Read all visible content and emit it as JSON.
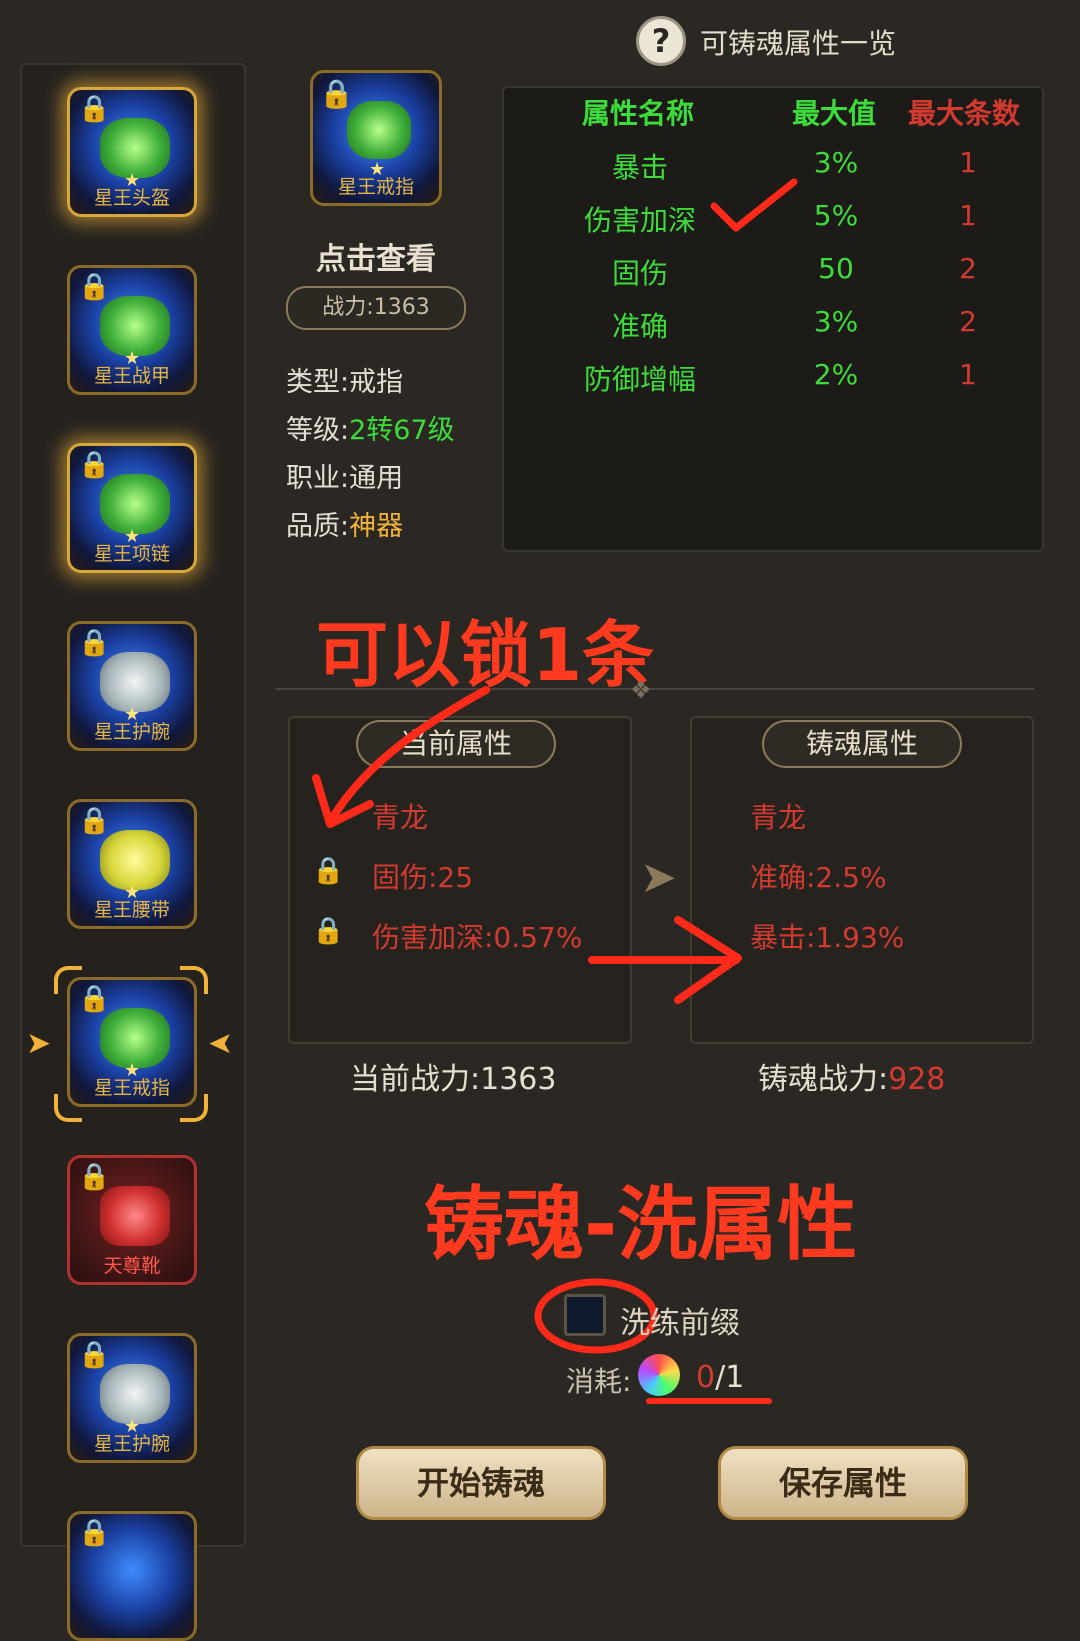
{
  "equipment_slots": [
    {
      "name": "星王头盔",
      "locked": true,
      "glow": true
    },
    {
      "name": "星王战甲",
      "locked": true,
      "glow": false
    },
    {
      "name": "星王项链",
      "locked": true,
      "glow": true
    },
    {
      "name": "星王护腕",
      "locked": true,
      "glow": false
    },
    {
      "name": "星王腰带",
      "locked": true,
      "glow": false
    },
    {
      "name": "星王戒指",
      "locked": true,
      "glow": false,
      "selected": true
    },
    {
      "name": "天尊靴",
      "locked": true,
      "glow": false
    },
    {
      "name": "星王护腕",
      "locked": true,
      "glow": false
    }
  ],
  "item": {
    "icon_label": "星王戒指",
    "click_view": "点击查看",
    "power": "战力:1363",
    "type_label": "类型:",
    "type_value": "戒指",
    "level_label": "等级:",
    "level_value": "2转67级",
    "class_label": "职业:",
    "class_value": "通用",
    "quality_label": "品质:",
    "quality_value": "神器"
  },
  "header": {
    "help_icon": "?",
    "title": "可铸魂属性一览"
  },
  "attr_table": {
    "headers": [
      "属性名称",
      "最大值",
      "最大条数"
    ],
    "rows": [
      [
        "暴击",
        "3%",
        "1"
      ],
      [
        "伤害加深",
        "5%",
        "1"
      ],
      [
        "固伤",
        "50",
        "2"
      ],
      [
        "准确",
        "3%",
        "2"
      ],
      [
        "防御增幅",
        "2%",
        "1"
      ]
    ]
  },
  "current_attrs": {
    "title": "当前属性",
    "prefix": "青龙",
    "lines": [
      "固伤:25",
      "伤害加深:0.57%"
    ]
  },
  "forged_attrs": {
    "title": "铸魂属性",
    "prefix": "青龙",
    "lines": [
      "准确:2.5%",
      "暴击:1.93%"
    ]
  },
  "current_power": "当前战力:1363",
  "forged_power_label": "铸魂战力:",
  "forged_power_value": "928",
  "annotations": {
    "lock_note": "可以锁1条",
    "caption": "铸魂-洗属性"
  },
  "refine_prefix_label": "洗练前缀",
  "cost_label": "消耗:",
  "cost_have": "0",
  "cost_need": "/1",
  "buttons": {
    "start": "开始铸魂",
    "save": "保存属性"
  },
  "colors": {
    "green": "#3ddc3a",
    "red": "#d23a30",
    "gold": "#f2b53a",
    "annotation": "#ff3a1e"
  }
}
